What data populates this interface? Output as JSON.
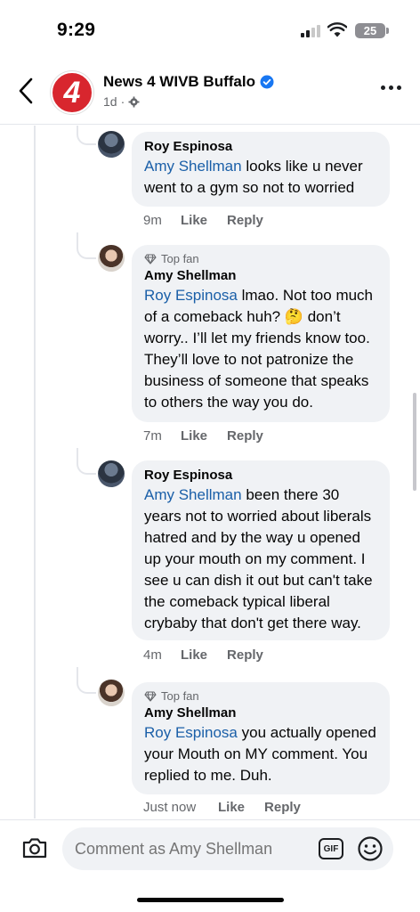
{
  "status": {
    "time": "9:29",
    "battery": "25"
  },
  "header": {
    "logo_text": "4",
    "page_name": "News 4 WIVB Buffalo",
    "meta_time": "1d",
    "meta_sep": "·"
  },
  "comments": [
    {
      "author": "Roy Espinosa",
      "top_fan": "",
      "mention": "Amy Shellman",
      "text": " looks like u never went to a gym so not to worried",
      "time": "9m",
      "like": "Like",
      "reply": "Reply"
    },
    {
      "author": "Amy Shellman",
      "top_fan": "Top fan",
      "mention": "Roy Espinosa",
      "text": " lmao.  Not too much of a comeback huh? 🤔 don’t worry..  I’ll let my friends know too. They’ll love to not patronize the business of someone that speaks to others the way you do.",
      "time": "7m",
      "like": "Like",
      "reply": "Reply"
    },
    {
      "author": "Roy Espinosa",
      "top_fan": "",
      "mention": "Amy Shellman",
      "text": " been there 30 years not to worried about liberals hatred and by the way u opened up your mouth on my comment. I see u can dish it out but can't take the comeback typical liberal crybaby that don't get there way.",
      "time": "4m",
      "like": "Like",
      "reply": "Reply"
    },
    {
      "author": "Amy Shellman",
      "top_fan": "Top fan",
      "mention": "Roy Espinosa",
      "text": " you actually opened your Mouth on MY comment.  You replied to me.  Duh.",
      "time": "Just now",
      "like": "Like",
      "reply": "Reply"
    }
  ],
  "composer": {
    "placeholder": "Comment as Amy Shellman",
    "gif_label": "GIF"
  },
  "colors": {
    "mention": "#1a5fa8",
    "verified": "#1877f2",
    "logo_red": "#d8262e",
    "bubble": "#f0f2f5"
  },
  "icons": [
    "back-arrow-icon",
    "verified-badge-icon",
    "globe-settings-icon",
    "more-options-icon",
    "top-fan-diamond-icon",
    "camera-icon",
    "gif-icon",
    "emoji-icon"
  ]
}
